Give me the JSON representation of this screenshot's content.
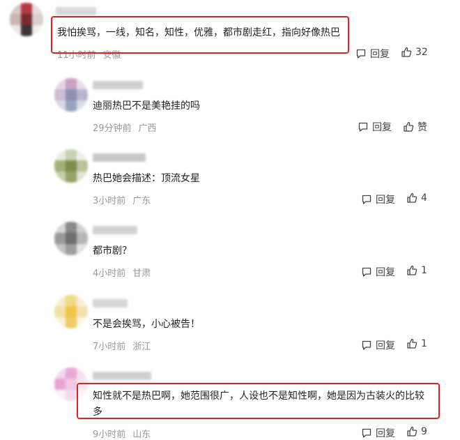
{
  "comments": [
    {
      "text": "我怕挨骂，一线，知名，知性，优雅，都市剧走红，指向好像热巴",
      "time": "11小时前",
      "region": "安徽",
      "reply": "回复",
      "likes": "32"
    },
    {
      "text": "迪丽热巴不是美艳挂的吗",
      "time": "29分钟前",
      "region": "广西",
      "reply": "回复",
      "likes": "赞"
    },
    {
      "text": "热巴她会描述：顶流女星",
      "time": "3小时前",
      "region": "广东",
      "reply": "回复",
      "likes": "4"
    },
    {
      "text": "都市剧？",
      "time": "4小时前",
      "region": "甘肃",
      "reply": "回复",
      "likes": "1"
    },
    {
      "text": "不是会挨骂，小心被告！",
      "time": "7小时前",
      "region": "浙江",
      "reply": "回复",
      "likes": "1"
    },
    {
      "text_line1": "知性就不是热巴啊，她范围很广，人设也不是知性啊，她是因为古装火的比较",
      "text_line2": "多",
      "time": "9小时前",
      "region": "山东",
      "reply": "回复",
      "likes": "9"
    }
  ],
  "colors": {
    "highlight": "#e02222",
    "meta": "#999999",
    "text": "#222222"
  },
  "icons": {
    "reply": "comment-bubble-icon",
    "like": "thumbs-up-icon"
  }
}
